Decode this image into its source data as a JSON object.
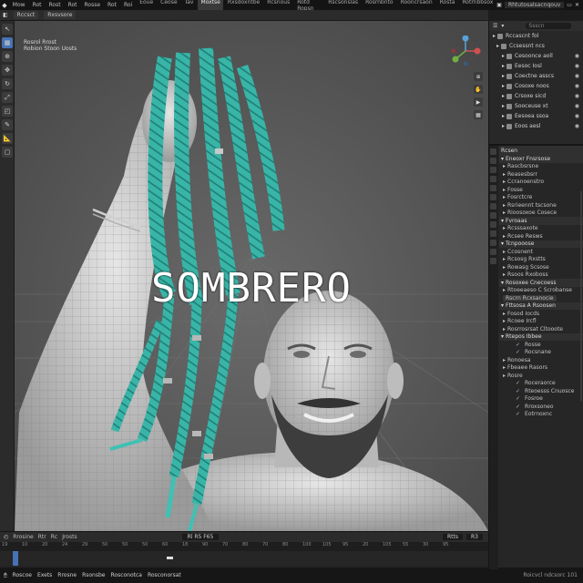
{
  "topbar": {
    "app_icon": "blender-logo-icon",
    "menus": [
      "Mow",
      "Rot",
      "Rost",
      "Rot",
      "Rosse",
      "Rot",
      "Roi"
    ],
    "tabs": [
      {
        "label": "Eoue",
        "active": false
      },
      {
        "label": "Ceose",
        "active": false
      },
      {
        "label": "Tav",
        "active": false
      },
      {
        "label": "Moxtse",
        "active": true
      },
      {
        "label": "Rxsdoxntbe",
        "active": false
      },
      {
        "label": "Rcsnous",
        "active": false
      },
      {
        "label": "Rotd Ropsn",
        "active": false
      },
      {
        "label": "Rscsonslas",
        "active": false
      },
      {
        "label": "Rosrnbnto",
        "active": false
      },
      {
        "label": "Rooncrsaon",
        "active": false
      },
      {
        "label": "Rosta",
        "active": false
      },
      {
        "label": "Rotrnbbsox",
        "active": false
      }
    ],
    "scene_label": "Rhtutosalsacnqouv"
  },
  "viewport_header": {
    "mode": "Rccsct",
    "view": "Rxsvsore"
  },
  "viewport": {
    "info_line1": "Rosrol Rrost",
    "info_line2": "Robion Stoon Uosts",
    "overlay_title": "SOMBRERO"
  },
  "timeline": {
    "menu1": "Rrosine",
    "menu2": "Rtr",
    "menu3": "Rc",
    "menu4": "Jrosts",
    "frame_label": "Rl R5 F65",
    "end_field": "Rtts",
    "extra_field": "R3",
    "ruler": [
      "19",
      "10",
      "20",
      "24",
      "29",
      "50",
      "50",
      "50",
      "60",
      "18",
      "90",
      "70",
      "80",
      "70",
      "80",
      "100",
      "105",
      "95",
      "20",
      "105",
      "55",
      "30",
      "95"
    ],
    "current_frame": "2"
  },
  "statusbar": {
    "items": [
      "Roscoe",
      "Exets",
      "Rrosne",
      "Rsonsbe",
      "Rosconotca",
      "Rosconorsat"
    ],
    "right": "Roicvcl ndcsorc 101"
  },
  "outliner": {
    "header_label": "Rcscn",
    "search_placeholder": "Ssscn",
    "rows": [
      {
        "label": "Rccascnt fol",
        "indent": 4,
        "visible": false
      },
      {
        "label": "Ccsessnt ncs",
        "indent": 8,
        "visible": false
      },
      {
        "label": "Cesoonce aoll",
        "indent": 14,
        "visible": true
      },
      {
        "label": "Eesoc Iosl",
        "indent": 14,
        "visible": true
      },
      {
        "label": "Coectne asscs",
        "indent": 14,
        "visible": true
      },
      {
        "label": "Cosoxe noos",
        "indent": 14,
        "visible": true
      },
      {
        "label": "Crsoxe sicd",
        "indent": 14,
        "visible": true
      },
      {
        "label": "Sooceuse xt",
        "indent": 14,
        "visible": true
      },
      {
        "label": "Eesoea ssoa",
        "indent": 14,
        "visible": true
      },
      {
        "label": "Eoos aesl",
        "indent": 14,
        "visible": true
      }
    ]
  },
  "properties": {
    "header_label": "Rcsen",
    "rows": [
      {
        "label": "Eneoxr Fnsrsose",
        "kind": "hdr"
      },
      {
        "label": "Rascbsrsne",
        "kind": "row"
      },
      {
        "label": "Reasesbsrr",
        "kind": "row"
      },
      {
        "label": "Ccranoenstro",
        "kind": "row"
      },
      {
        "label": "Fosse",
        "kind": "row"
      },
      {
        "label": "Fosrctcre",
        "kind": "row"
      },
      {
        "label": "Rsrieennt tscsone",
        "kind": "row"
      },
      {
        "label": "Rioosoxoe Cosece",
        "kind": "row"
      },
      {
        "label": "Fvroaas",
        "kind": "hdr"
      },
      {
        "label": "Rcsssaxote",
        "kind": "row"
      },
      {
        "label": "Rcsee Resws",
        "kind": "row"
      },
      {
        "label": "Tcnpooose",
        "kind": "hdr"
      },
      {
        "label": "Ccosnent",
        "kind": "row"
      },
      {
        "label": "Rcsosg Rxstts",
        "kind": "row"
      },
      {
        "label": "Rowasg Scsose",
        "kind": "row"
      },
      {
        "label": "Rsoos Rxoboss",
        "kind": "row"
      },
      {
        "label": "Rosoxee Cnecoess",
        "kind": "hdr"
      },
      {
        "label": "Rtoeeaeso C Scrobanse",
        "kind": "row"
      },
      {
        "label": "Rscrn Rcxsanocie",
        "kind": "field"
      },
      {
        "label": "Fttsosa A Rsoosen",
        "kind": "hdr"
      },
      {
        "label": "Fosod Iocds",
        "kind": "row"
      },
      {
        "label": "Rcoee Ircfl",
        "kind": "row"
      },
      {
        "label": "Rosrrosrsat Cltooote",
        "kind": "row"
      },
      {
        "label": "Rtepos Ibbee",
        "kind": "hdr"
      },
      {
        "label": "Rosse",
        "kind": "check"
      },
      {
        "label": "Rocsnane",
        "kind": "check"
      },
      {
        "label": "Ronoesa",
        "kind": "row"
      },
      {
        "label": "Fbeaee Rasors",
        "kind": "row"
      },
      {
        "label": "Rosre",
        "kind": "row"
      },
      {
        "label": "Roceraorce",
        "kind": "check"
      },
      {
        "label": "Rteoesss Cnuosce",
        "kind": "check"
      },
      {
        "label": "Fosroe",
        "kind": "check"
      },
      {
        "label": "Rroxsoneo",
        "kind": "check"
      },
      {
        "label": "Eotrnoxnc",
        "kind": "check"
      }
    ]
  }
}
